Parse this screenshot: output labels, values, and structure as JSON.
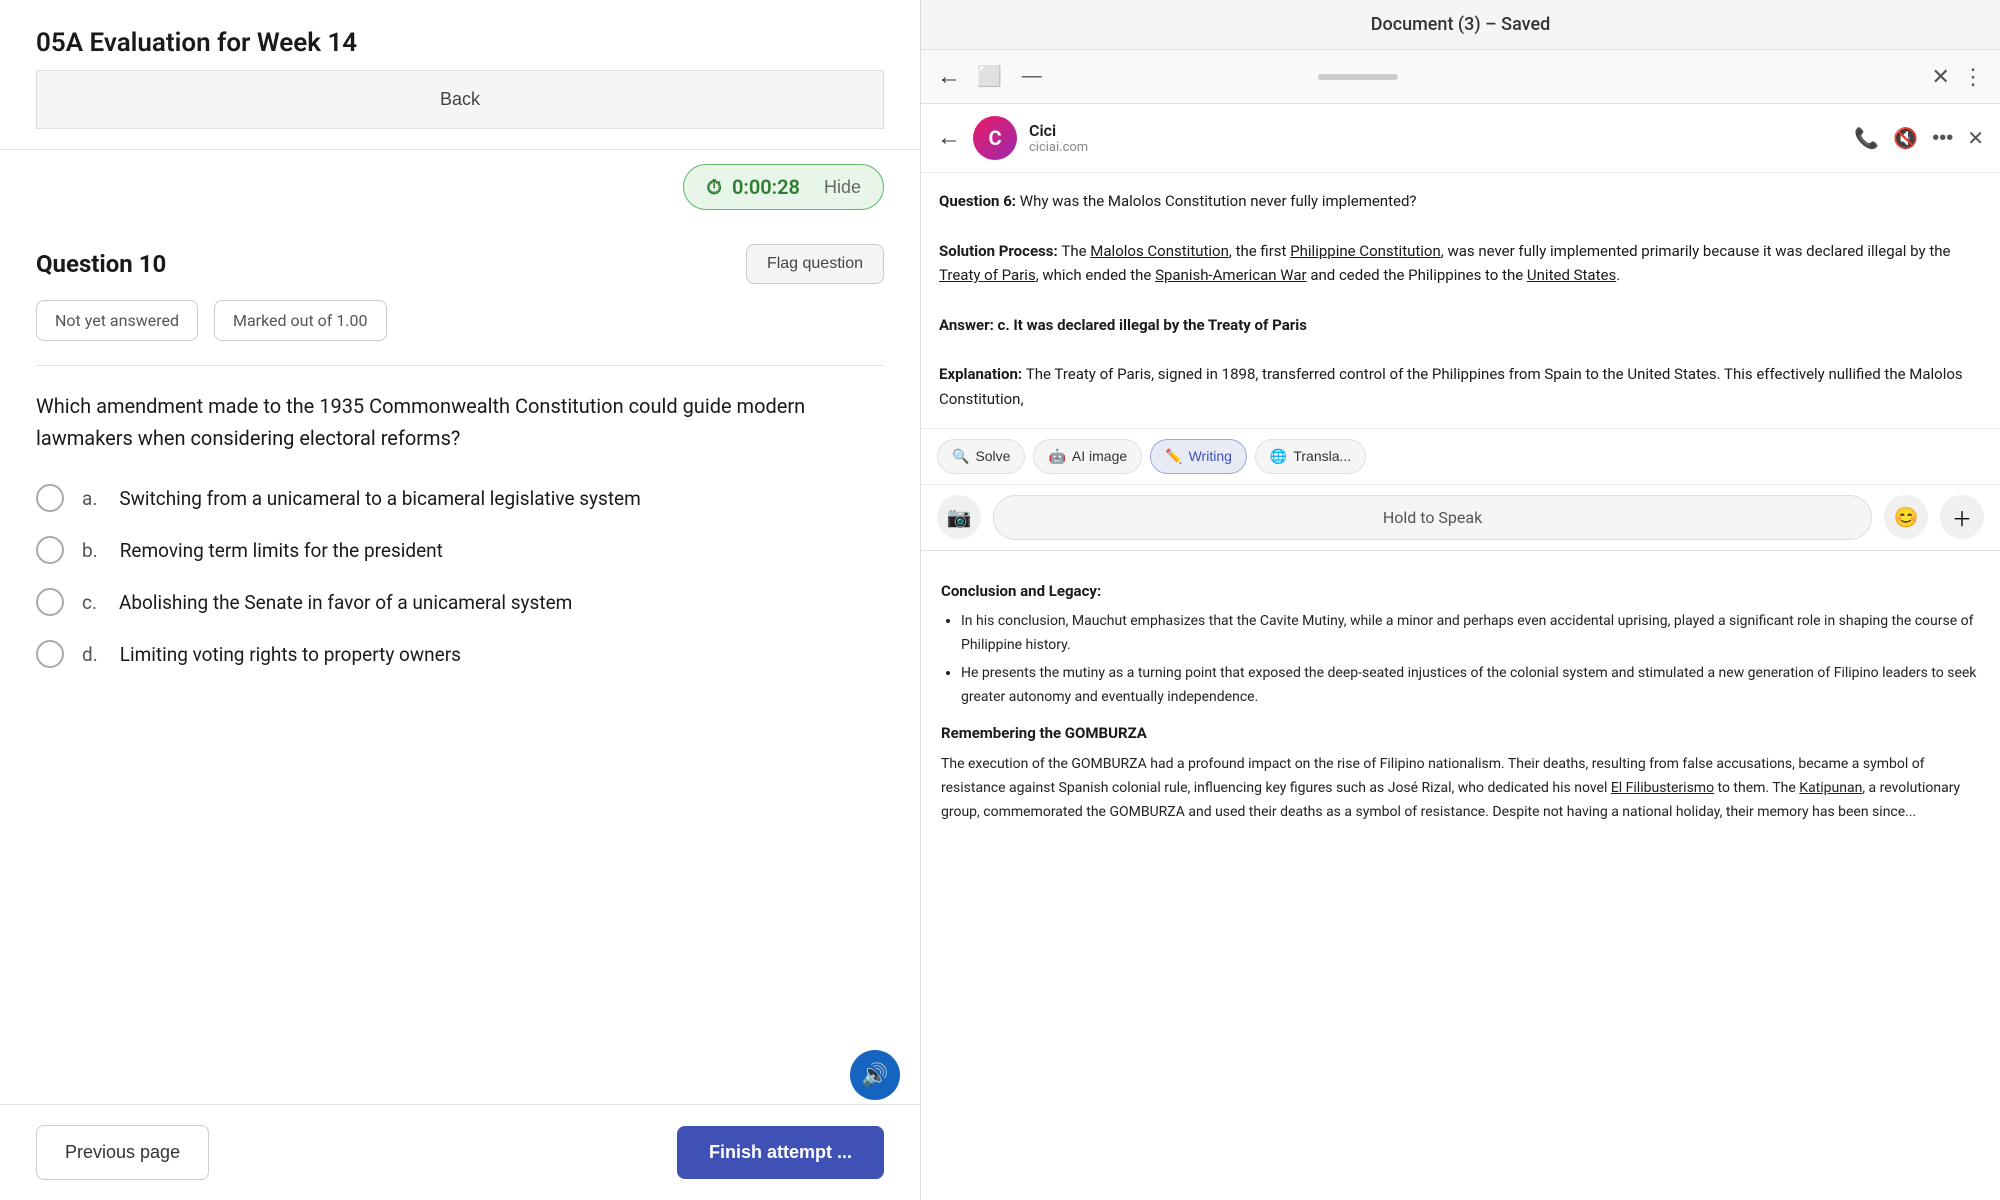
{
  "quiz": {
    "title": "05A Evaluation for Week 14",
    "back_label": "Back",
    "timer": "0:00:28",
    "hide_label": "Hide",
    "question_number": "Question 10",
    "flag_label": "Flag question",
    "status_not_answered": "Not yet answered",
    "status_marked": "Marked out of 1.00",
    "question_text": "Which amendment made to the 1935 Commonwealth Constitution could guide modern lawmakers when considering electoral reforms?",
    "options": [
      {
        "letter": "a.",
        "text": "Switching from a unicameral to a bicameral legislative system"
      },
      {
        "letter": "b.",
        "text": "Removing term limits for the president"
      },
      {
        "letter": "c.",
        "text": "Abolishing the Senate in favor of a unicameral system"
      },
      {
        "letter": "d.",
        "text": "Limiting voting rights to property owners"
      }
    ],
    "prev_label": "Previous page",
    "finish_label": "Finish attempt ..."
  },
  "document": {
    "title": "Document (3) – Saved",
    "assistant": {
      "name": "Cici",
      "domain": "ciciai.com",
      "avatar_letter": "C",
      "question_label": "Question 6:",
      "question_text": "Why was the Malolos Constitution never fully implemented?",
      "solution_label": "Solution Process:",
      "solution_text": "The Malolos Constitution, the first Philippine Constitution, was never fully implemented primarily because it was declared illegal by the Treaty of Paris, which ended the Spanish-American War and ceded the Philippines to the United States.",
      "answer_label": "Answer:",
      "answer_text": "c. It was declared illegal by the Treaty of Paris",
      "explanation_label": "Explanation:",
      "explanation_text": "The Treaty of Paris, signed in 1898, transferred control of the Philippines from Spain to the United States. This effectively nullified the Malolos Constitution,",
      "tools": [
        "Solve",
        "AI image",
        "Writing",
        "Transla..."
      ],
      "hold_to_speak": "Hold to Speak"
    },
    "doc_sections": [
      {
        "heading": "Conclusion and Legacy:",
        "bullets": [
          "In his conclusion, Mauchut emphasizes that the Cavite Mutiny, while a minor and perhaps even accidental uprising, played a significant role in shaping the course of Philippine history.",
          "He presents the mutiny as a turning point that exposed the deep-seated injustices of the colonial system and stimulated a new generation of Filipino leaders to seek greater autonomy and eventually independence."
        ]
      },
      {
        "heading": "Remembering the GOMBURZA",
        "bullets": [
          "The execution of the GOMBURZA had a profound impact on the rise of Filipino nationalism. Their deaths, resulting from false accusations, became a symbol of resistance against Spanish colonial rule, influencing key figures such as José Rizal, who dedicated his novel El Filibusterismo to them. The Katipunan, a revolutionary group, commemorated the GOMBURZA and used their deaths as a symbol of resistance. Despite not having a national holiday, their memory has been since..."
        ]
      }
    ]
  }
}
